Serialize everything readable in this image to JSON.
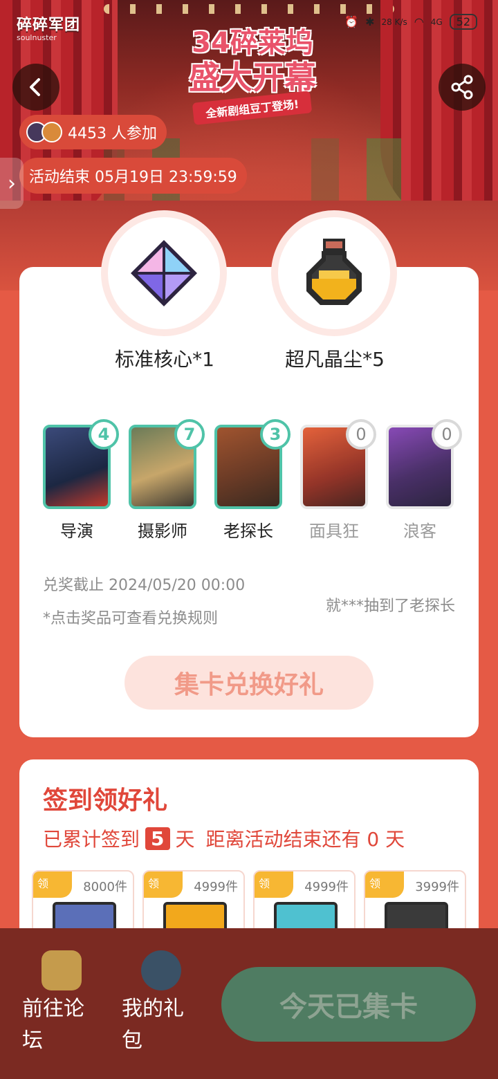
{
  "statusbar": {
    "net_speed": "28 K/s",
    "signal": "4G",
    "battery": "52"
  },
  "brand": {
    "logo_text": "碎碎军团",
    "sub_text": "soulnuster"
  },
  "event": {
    "title_line1": "34碎莱坞",
    "title_line2": "盛大开幕",
    "ribbon": "全新剧组豆丁登场!"
  },
  "participants": {
    "count_text": "4453 人参加"
  },
  "end_time": "活动结束 05月19日 23:59:59",
  "prizes": [
    {
      "label": "标准核心*1",
      "icon": "crystal-core-icon"
    },
    {
      "label": "超凡晶尘*5",
      "icon": "golden-potion-icon"
    }
  ],
  "characters": [
    {
      "name": "导演",
      "count": "4",
      "owned": true
    },
    {
      "name": "摄影师",
      "count": "7",
      "owned": true
    },
    {
      "name": "老探长",
      "count": "3",
      "owned": true
    },
    {
      "name": "面具狂",
      "count": "0",
      "owned": false
    },
    {
      "name": "浪客",
      "count": "0",
      "owned": false
    }
  ],
  "rules": {
    "deadline": "兑奖截止 2024/05/20 00:00",
    "hint": "*点击奖品可查看兑换规则",
    "ticker": "就***抽到了老探长"
  },
  "redeem_button": "集卡兑换好礼",
  "signin": {
    "title": "签到领好礼",
    "prefix": "已累计签到",
    "days": "5",
    "days_unit": "天",
    "remaining_text": "距离活动结束还有 0 天",
    "gifts": [
      {
        "tag": "领",
        "stock": "8000件"
      },
      {
        "tag": "领",
        "stock": "4999件"
      },
      {
        "tag": "领",
        "stock": "4999件"
      },
      {
        "tag": "领",
        "stock": "3999件"
      }
    ]
  },
  "bottom": {
    "forum_label": "前往论坛",
    "gifts_label": "我的礼包",
    "today_button": "今天已集卡"
  },
  "colors": {
    "accent": "#e0473a",
    "owned_border": "#4fc3a8",
    "bottom_bar": "#7b2a22",
    "today_button": "#4f7c62"
  }
}
